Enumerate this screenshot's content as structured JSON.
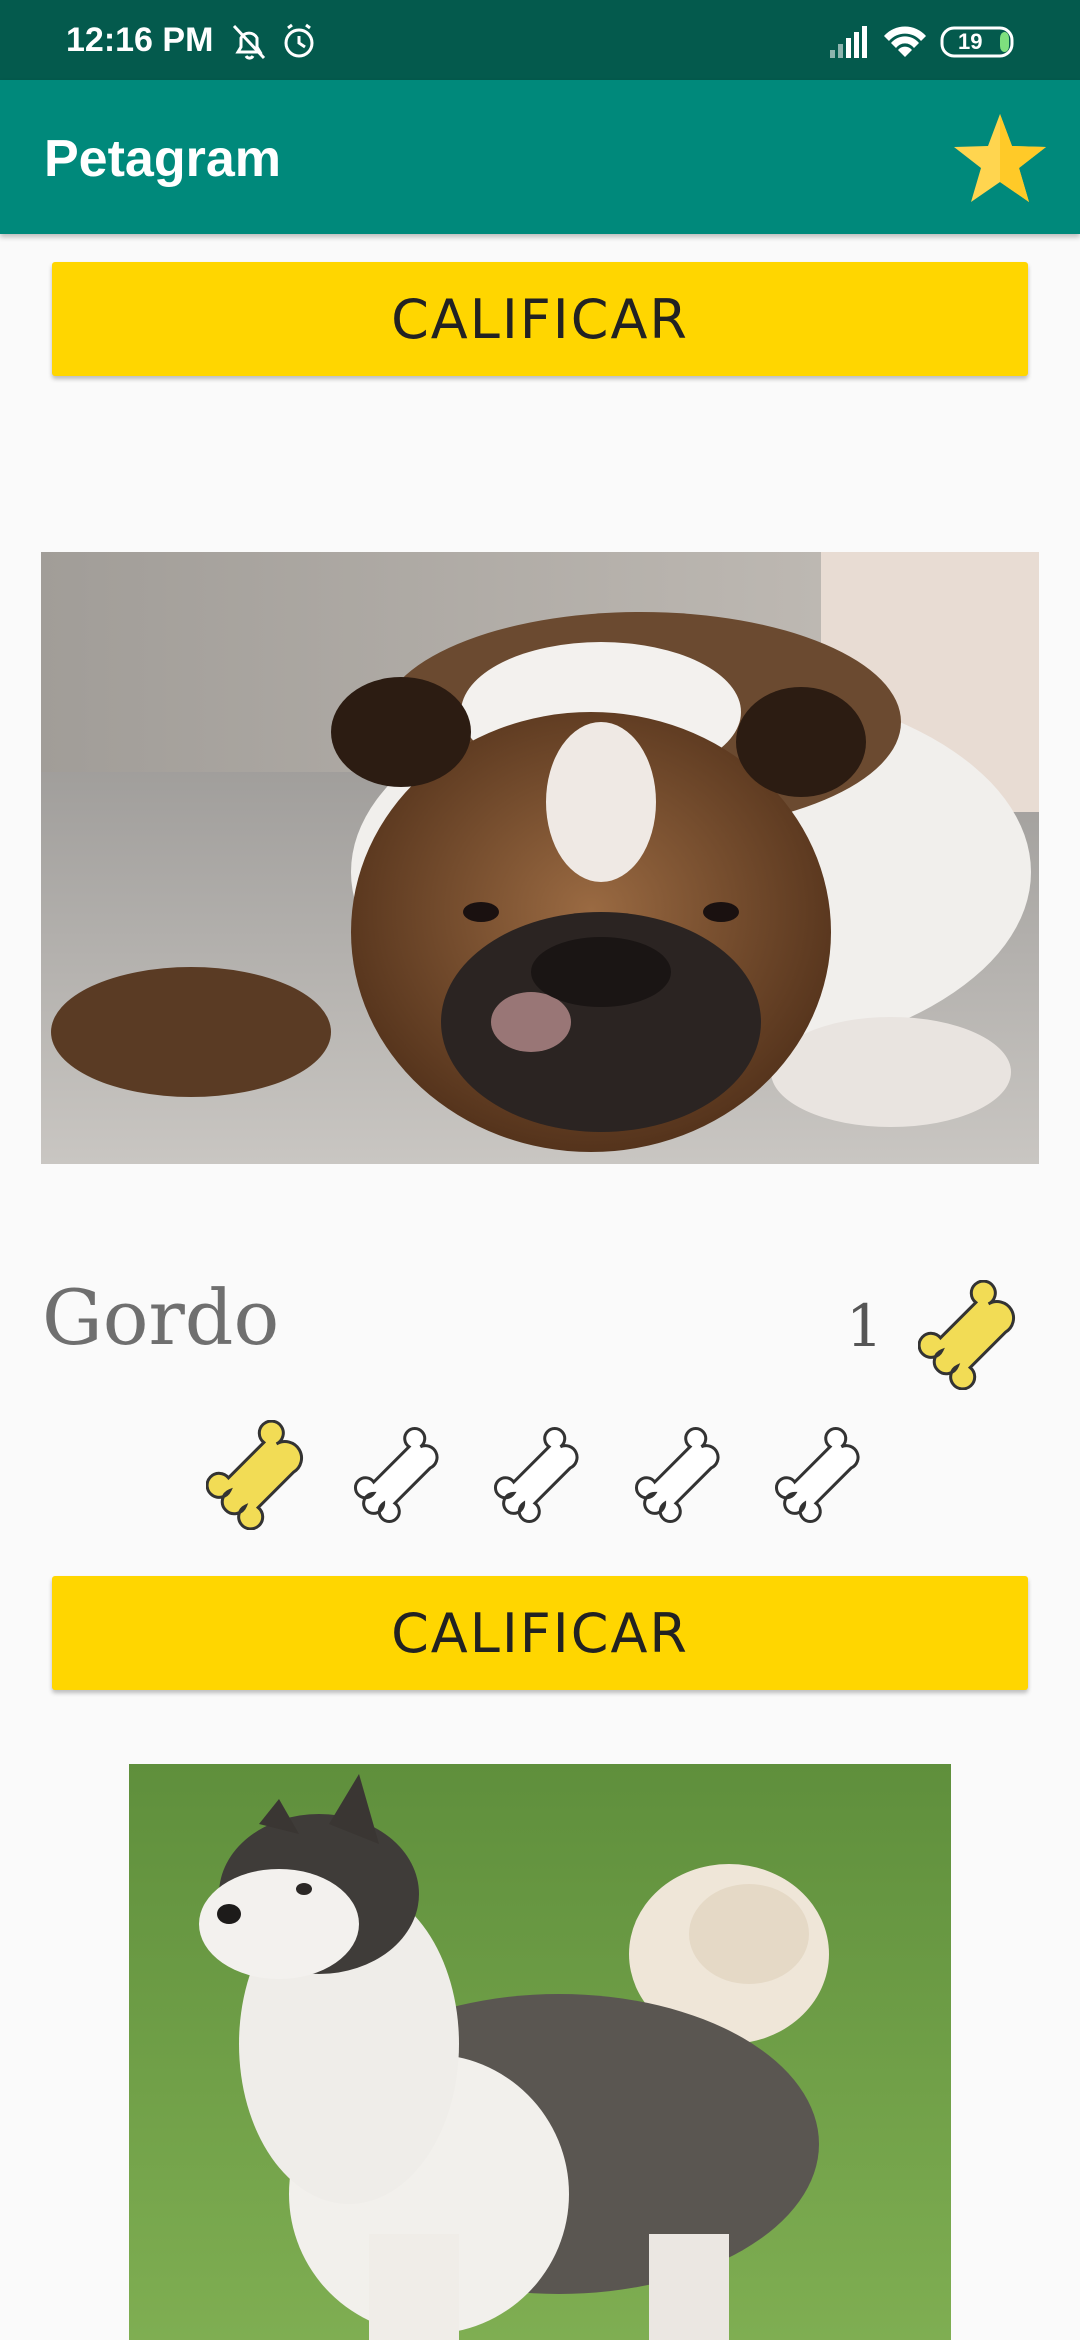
{
  "status_bar": {
    "time": "12:16 PM",
    "battery_level": "19",
    "icons": [
      "notifications-off-icon",
      "alarm-icon",
      "signal-icon",
      "wifi-icon",
      "battery-icon"
    ]
  },
  "app_bar": {
    "title": "Petagram",
    "action_icon": "star-icon"
  },
  "buttons": {
    "rate_top_label": "CALIFICAR",
    "rate_bottom_label": "CALIFICAR"
  },
  "pet": {
    "name": "Gordo",
    "likes": "1",
    "photo": "bulldog-photo",
    "rating_value": 1,
    "rating_max": 5,
    "rating_icon": "bone-icon"
  },
  "next_pet": {
    "photo": "husky-photo"
  },
  "colors": {
    "status_bar": "#045a4d",
    "app_bar": "#00897b",
    "button": "#ffd600",
    "bone_filled": "#f2dc55",
    "bone_empty": "#ffffff",
    "background": "#fafafa"
  }
}
